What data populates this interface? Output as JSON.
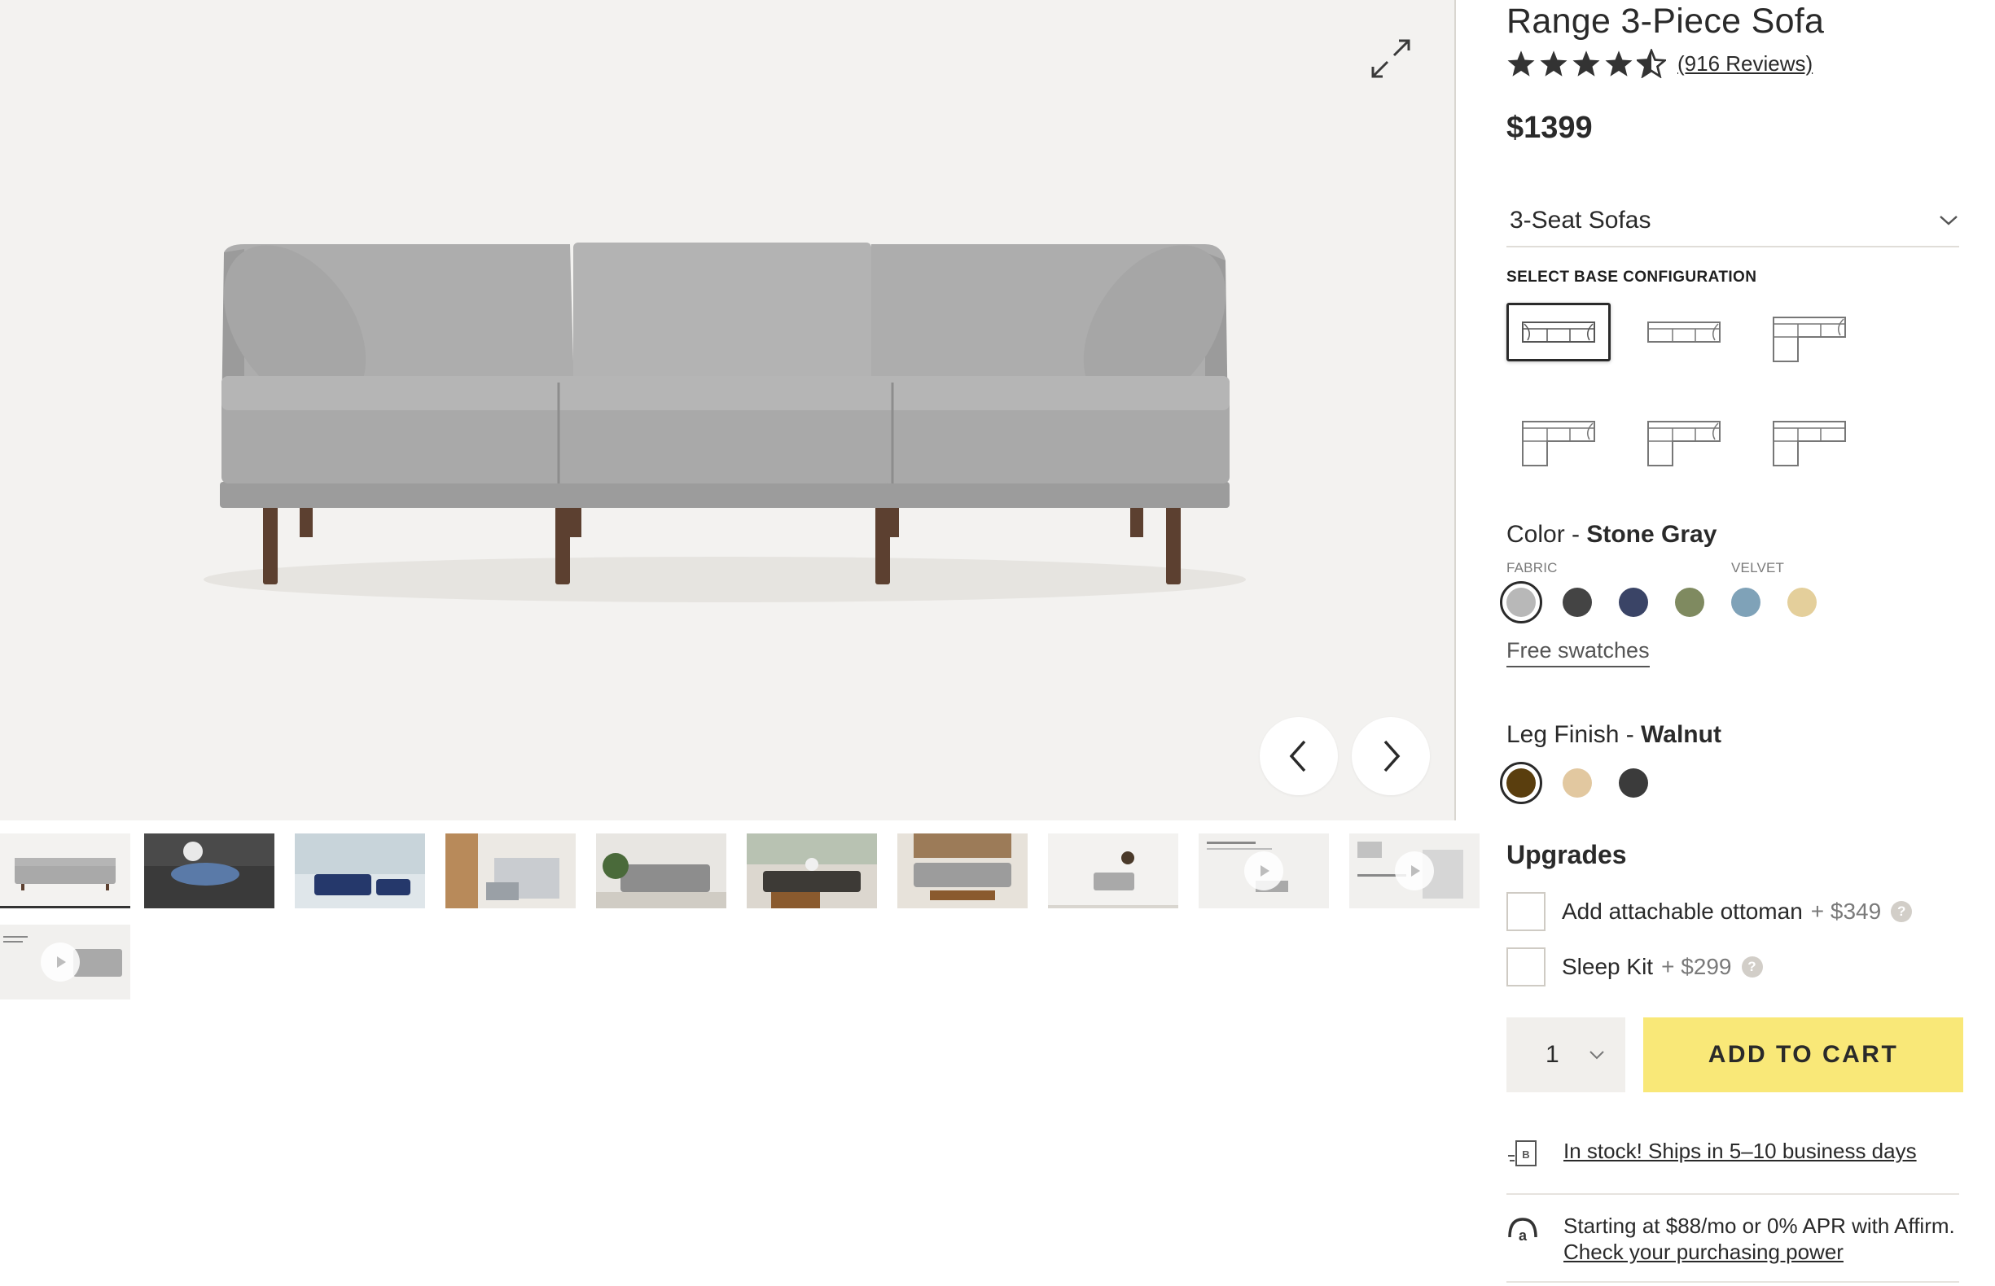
{
  "product": {
    "title": "Range 3-Piece Sofa",
    "rating": 4.5,
    "reviews_label": "(916 Reviews)",
    "price": "$1399"
  },
  "category_select": {
    "value": "3-Seat Sofas"
  },
  "base_configuration": {
    "label": "SELECT BASE CONFIGURATION",
    "options": [
      "sofa",
      "armless-sofa",
      "sectional-left",
      "sectional-left-2",
      "sectional-right",
      "sectional-right-2"
    ],
    "selected_index": 0
  },
  "color": {
    "label": "Color - ",
    "value": "Stone Gray",
    "fabric_label": "FABRIC",
    "velvet_label": "VELVET",
    "swatches": [
      "#b8b8b8",
      "#444444",
      "#3a4466",
      "#7f8a60",
      "#7fa2b8",
      "#e4cf9b"
    ],
    "selected_index": 0
  },
  "free_swatches_label": "Free swatches",
  "leg_finish": {
    "label": "Leg Finish - ",
    "value": "Walnut",
    "swatches": [
      "#5a3e0e",
      "#e2c8a0",
      "#3b3b3b"
    ],
    "selected_index": 0
  },
  "upgrades": {
    "title": "Upgrades",
    "items": [
      {
        "name": "Add attachable ottoman",
        "price": "+ $349"
      },
      {
        "name": "Sleep Kit",
        "price": "+ $299"
      }
    ]
  },
  "purchase": {
    "quantity": "1",
    "add_to_cart_label": "ADD TO CART"
  },
  "shipping": {
    "text": "In stock! Ships in 5–10 business days"
  },
  "financing": {
    "text": "Starting at $88/mo or 0% APR with Affirm.",
    "link": "Check your purchasing power"
  },
  "gallery": {
    "thumbnail_count": 11,
    "active_index": 0
  },
  "colors": {
    "accent_yellow": "#f9e878",
    "hero_bg": "#f3f2f0",
    "text": "#2a2a2a"
  }
}
